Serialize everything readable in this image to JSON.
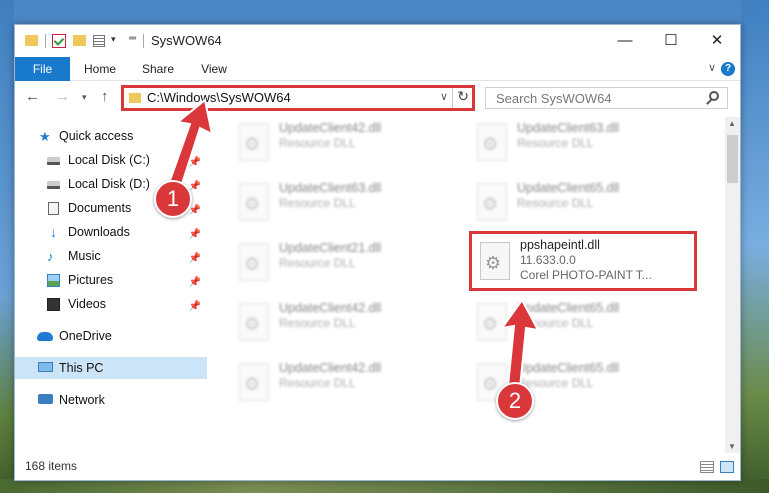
{
  "window": {
    "title": "SysWOW64",
    "minimize_glyph": "—",
    "maximize_glyph": "☐",
    "close_glyph": "✕"
  },
  "ribbon": {
    "tabs": [
      "File",
      "Home",
      "Share",
      "View"
    ],
    "help_glyph": "?"
  },
  "address": {
    "path": "C:\\Windows\\SysWOW64",
    "search_placeholder": "Search SysWOW64"
  },
  "nav": {
    "items": [
      {
        "label": "Quick access",
        "icon": "star-icon",
        "pinned": false
      },
      {
        "label": "Local Disk (C:)",
        "icon": "disk-icon",
        "pinned": true
      },
      {
        "label": "Local Disk (D:)",
        "icon": "disk-icon",
        "pinned": true
      },
      {
        "label": "Documents",
        "icon": "document-icon",
        "pinned": true
      },
      {
        "label": "Downloads",
        "icon": "download-icon",
        "pinned": true
      },
      {
        "label": "Music",
        "icon": "music-icon",
        "pinned": true
      },
      {
        "label": "Pictures",
        "icon": "pictures-icon",
        "pinned": true
      },
      {
        "label": "Videos",
        "icon": "video-icon",
        "pinned": true
      },
      {
        "label": "OneDrive",
        "icon": "cloud-icon",
        "pinned": false
      },
      {
        "label": "This PC",
        "icon": "pc-icon",
        "pinned": false,
        "selected": true
      },
      {
        "label": "Network",
        "icon": "network-icon",
        "pinned": false
      }
    ]
  },
  "files": [
    {
      "name": "UpdateClient42.dll",
      "line2": "Resource DLL",
      "line3": "",
      "blurred": true
    },
    {
      "name": "UpdateClient63.dll",
      "line2": "Resource DLL",
      "line3": "",
      "blurred": true
    },
    {
      "name": "UpdateClient63.dll",
      "line2": "Resource DLL",
      "line3": "",
      "blurred": true
    },
    {
      "name": "UpdateClient65.dll",
      "line2": "Resource DLL",
      "line3": "",
      "blurred": true
    },
    {
      "name": "UpdateClient21.dll",
      "line2": "Resource DLL",
      "line3": "",
      "blurred": true
    },
    {
      "name": "ppshapeintl.dll",
      "line2": "11.633.0.0",
      "line3": "Corel PHOTO-PAINT T...",
      "blurred": false,
      "highlighted": true
    },
    {
      "name": "UpdateClient42.dll",
      "line2": "Resource DLL",
      "line3": "",
      "blurred": true
    },
    {
      "name": "UpdateClient65.dll",
      "line2": "Resource DLL",
      "line3": "",
      "blurred": true
    },
    {
      "name": "UpdateClient42.dll",
      "line2": "Resource DLL",
      "line3": "",
      "blurred": true
    },
    {
      "name": "UpdateClient65.dll",
      "line2": "Resource DLL",
      "line3": "",
      "blurred": true
    }
  ],
  "status": {
    "item_count": "168 items"
  },
  "annotations": {
    "step1": "1",
    "step2": "2",
    "accent": "#d9373a"
  }
}
